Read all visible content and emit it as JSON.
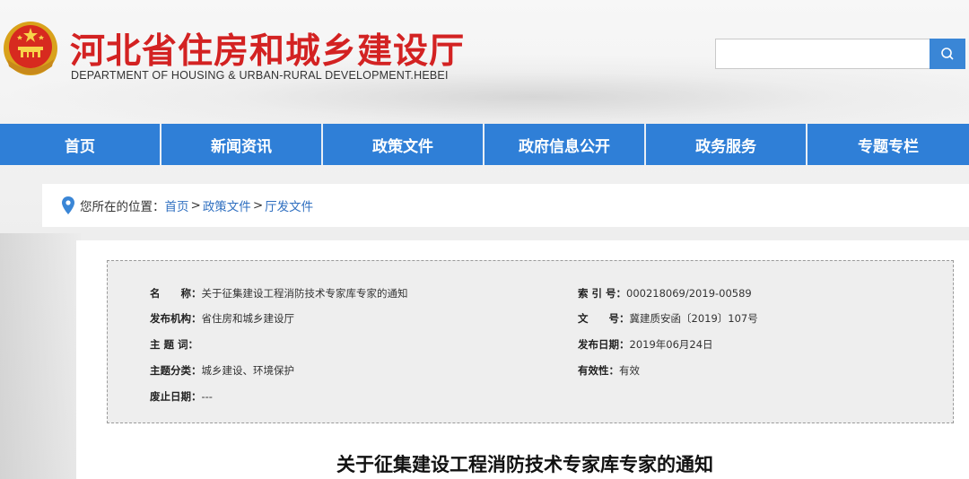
{
  "header": {
    "title": "河北省住房和城乡建设厅",
    "subtitle": "DEPARTMENT OF HOUSING & URBAN-RURAL DEVELOPMENT.HEBEI",
    "search_placeholder": "",
    "search_icon": "search-icon",
    "emblem_icon": "national-emblem-icon"
  },
  "nav": {
    "items": [
      "首页",
      "新闻资讯",
      "政策文件",
      "政府信息公开",
      "政务服务",
      "专题专栏"
    ]
  },
  "breadcrumb": {
    "prefix": "您所在的位置：",
    "links": [
      "首页",
      "政策文件",
      "厅发文件"
    ],
    "separator": ">"
  },
  "meta": {
    "name_label": "名　　称：",
    "name_value": "关于征集建设工程消防技术专家库专家的通知",
    "index_label": "索 引 号：",
    "index_value": "000218069/2019-00589",
    "publisher_label": "发布机构：",
    "publisher_value": "省住房和城乡建设厅",
    "docno_label": "文　　号：",
    "docno_value": "冀建质安函〔2019〕107号",
    "keywords_label": "主 题 词：",
    "keywords_value": "",
    "date_label": "发布日期：",
    "date_value": "2019年06月24日",
    "category_label": "主题分类：",
    "category_value": "城乡建设、环境保护",
    "validity_label": "有效性：",
    "validity_value": "有效",
    "expiry_label": "废止日期：",
    "expiry_value": "---"
  },
  "article": {
    "title": "关于征集建设工程消防技术专家库专家的通知"
  },
  "colors": {
    "brand_red": "#d32222",
    "nav_blue": "#2f7fd7",
    "link_blue": "#2f6fc0"
  }
}
